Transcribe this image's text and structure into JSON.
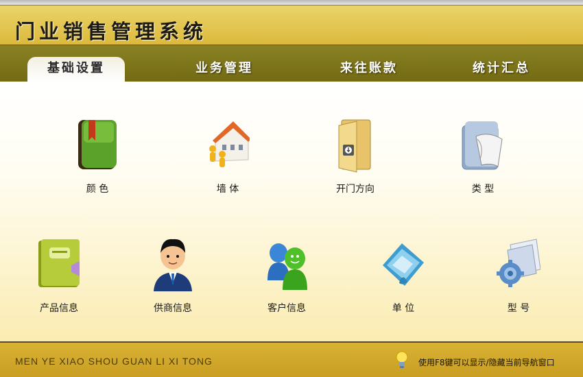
{
  "app": {
    "title": "门业销售管理系统"
  },
  "nav": {
    "tabs": [
      {
        "label": "基础设置",
        "active": true
      },
      {
        "label": "业务管理",
        "active": false
      },
      {
        "label": "来往账款",
        "active": false
      },
      {
        "label": "统计汇总",
        "active": false
      }
    ]
  },
  "items": [
    {
      "label": "颜    色",
      "icon": "green-book-icon"
    },
    {
      "label": "墙    体",
      "icon": "house-icon"
    },
    {
      "label": "开门方向",
      "icon": "open-folder-icon"
    },
    {
      "label": "类    型",
      "icon": "paper-folder-icon"
    },
    {
      "label": "产品信息",
      "icon": "product-book-icon"
    },
    {
      "label": "供商信息",
      "icon": "businessman-icon"
    },
    {
      "label": "客户信息",
      "icon": "chat-users-icon"
    },
    {
      "label": "单    位",
      "icon": "unit-folder-icon"
    },
    {
      "label": "型    号",
      "icon": "gear-document-icon"
    }
  ],
  "footer": {
    "brand": "MEN YE XIAO SHOU GUAN LI XI TONG",
    "hint": "使用F8键可以显示/隐藏当前导航窗口"
  },
  "colors": {
    "titlebar": "#dcb93c",
    "navbar": "#7a7118",
    "footer": "#d1a82a"
  }
}
